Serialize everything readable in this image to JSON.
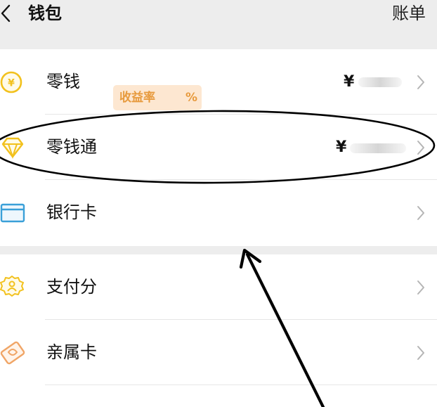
{
  "header": {
    "title": "钱包",
    "bill_label": "账单"
  },
  "group1": {
    "items": [
      {
        "label": "零钱",
        "currency": "¥",
        "icon": "yen-coin-icon"
      },
      {
        "label": "零钱通",
        "badge_label": "收益率",
        "badge_percent": "%",
        "currency": "¥",
        "icon": "diamond-icon"
      },
      {
        "label": "银行卡",
        "icon": "bank-card-icon"
      }
    ]
  },
  "group2": {
    "items": [
      {
        "label": "支付分",
        "icon": "credit-score-badge-icon"
      },
      {
        "label": "亲属卡",
        "icon": "family-card-icon"
      }
    ]
  },
  "colors": {
    "accent_yellow": "#f2c11d",
    "card_blue": "#3aa0d8",
    "badge_bg": "#fde7d1",
    "badge_text": "#e79a3d",
    "background": "#ededed"
  }
}
